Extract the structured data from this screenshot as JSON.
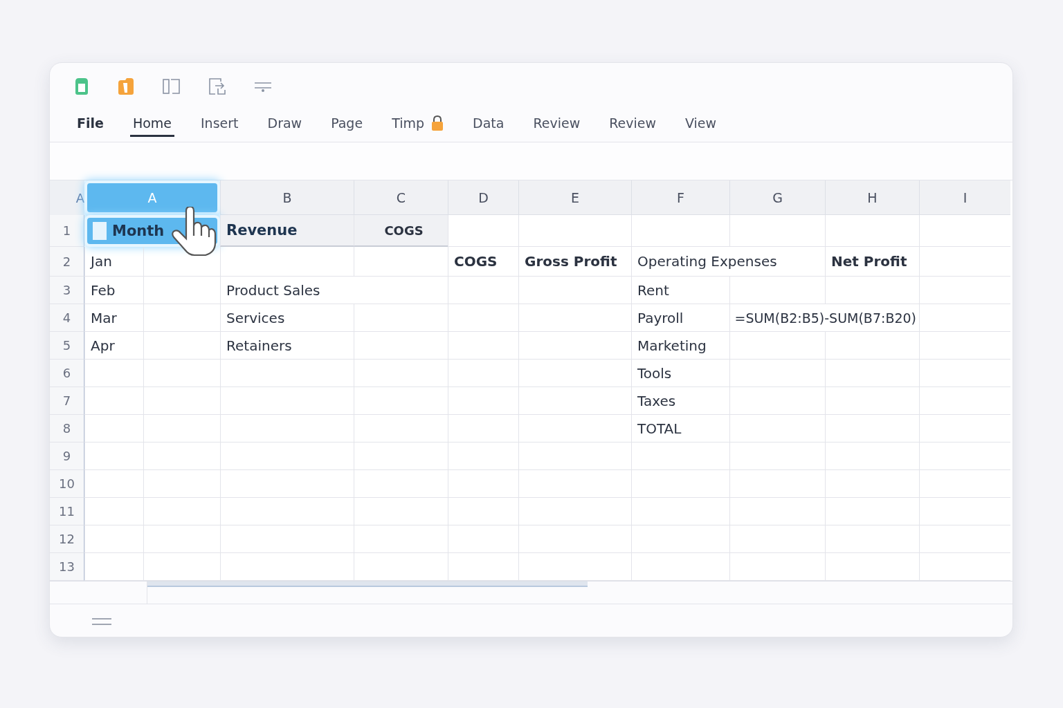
{
  "toolbar": {
    "icons": [
      {
        "kind": "green-doc"
      },
      {
        "kind": "orange-doc"
      },
      {
        "kind": "panel"
      },
      {
        "kind": "export"
      },
      {
        "kind": "filter"
      }
    ]
  },
  "tabs": [
    {
      "label": "File",
      "selected": false,
      "locked": false,
      "bold": true
    },
    {
      "label": "Home",
      "selected": true,
      "locked": false,
      "bold": false
    },
    {
      "label": "Insert",
      "selected": false,
      "locked": false,
      "bold": false
    },
    {
      "label": "Draw",
      "selected": false,
      "locked": false,
      "bold": false
    },
    {
      "label": "Page",
      "selected": false,
      "locked": false,
      "bold": false
    },
    {
      "label": "Timp",
      "selected": false,
      "locked": true,
      "bold": false
    },
    {
      "label": "Data",
      "selected": false,
      "locked": false,
      "bold": false
    },
    {
      "label": "Review",
      "selected": false,
      "locked": false,
      "bold": false
    },
    {
      "label": "Review",
      "selected": false,
      "locked": false,
      "bold": false
    },
    {
      "label": "View",
      "selected": false,
      "locked": false,
      "bold": false
    }
  ],
  "corner_label": "A",
  "columns": [
    {
      "label": "A",
      "selected": true
    },
    {
      "label": "B",
      "selected": false
    },
    {
      "label": "C",
      "selected": false
    },
    {
      "label": "D",
      "selected": false
    },
    {
      "label": "E",
      "selected": false
    },
    {
      "label": "F",
      "selected": false
    },
    {
      "label": "G",
      "selected": false
    },
    {
      "label": "H",
      "selected": false
    },
    {
      "label": "I",
      "selected": false
    }
  ],
  "rows": [
    {
      "number": "1",
      "cells": {
        "A": {
          "text": "Month",
          "bold": true,
          "checked": false
        },
        "B": {
          "text": "Revenue",
          "bold": true
        },
        "C": {
          "text": "COGS",
          "bold": true
        }
      }
    },
    {
      "number": "2",
      "cells": {
        "A": {
          "text": "Jan",
          "bold": false
        },
        "D": {
          "text": "COGS",
          "bold": true
        },
        "E": {
          "text": "Gross Profit",
          "bold": true
        },
        "F": {
          "text": "Operating Expenses",
          "bold": false
        },
        "H": {
          "text": "Net Profit",
          "bold": true
        }
      }
    },
    {
      "number": "3",
      "cells": {
        "A": {
          "text": "Feb",
          "bold": false
        },
        "B": {
          "text": "Product Sales",
          "bold": false
        },
        "F": {
          "text": "Rent",
          "bold": false
        }
      }
    },
    {
      "number": "4",
      "cells": {
        "A": {
          "text": "Mar",
          "bold": false
        },
        "B": {
          "text": "Services",
          "bold": false
        },
        "F": {
          "text": "Payroll",
          "bold": false
        },
        "G": {
          "text": "=SUM(B2:B5)-SUM(B7:B20)",
          "bold": false
        }
      }
    },
    {
      "number": "5",
      "cells": {
        "A": {
          "text": "Apr",
          "bold": false
        },
        "B": {
          "text": "Retainers",
          "bold": false
        },
        "F": {
          "text": "Marketing",
          "bold": false
        }
      }
    },
    {
      "number": "6",
      "cells": {
        "F": {
          "text": "Tools",
          "bold": false
        }
      }
    },
    {
      "number": "7",
      "cells": {
        "F": {
          "text": "Taxes",
          "bold": false
        }
      }
    },
    {
      "number": "8",
      "cells": {
        "F": {
          "text": "TOTAL",
          "bold": false
        }
      }
    },
    {
      "number": "9",
      "cells": {}
    },
    {
      "number": "10",
      "cells": {}
    },
    {
      "number": "11",
      "cells": {}
    },
    {
      "number": "12",
      "cells": {}
    },
    {
      "number": "13",
      "cells": {}
    }
  ]
}
